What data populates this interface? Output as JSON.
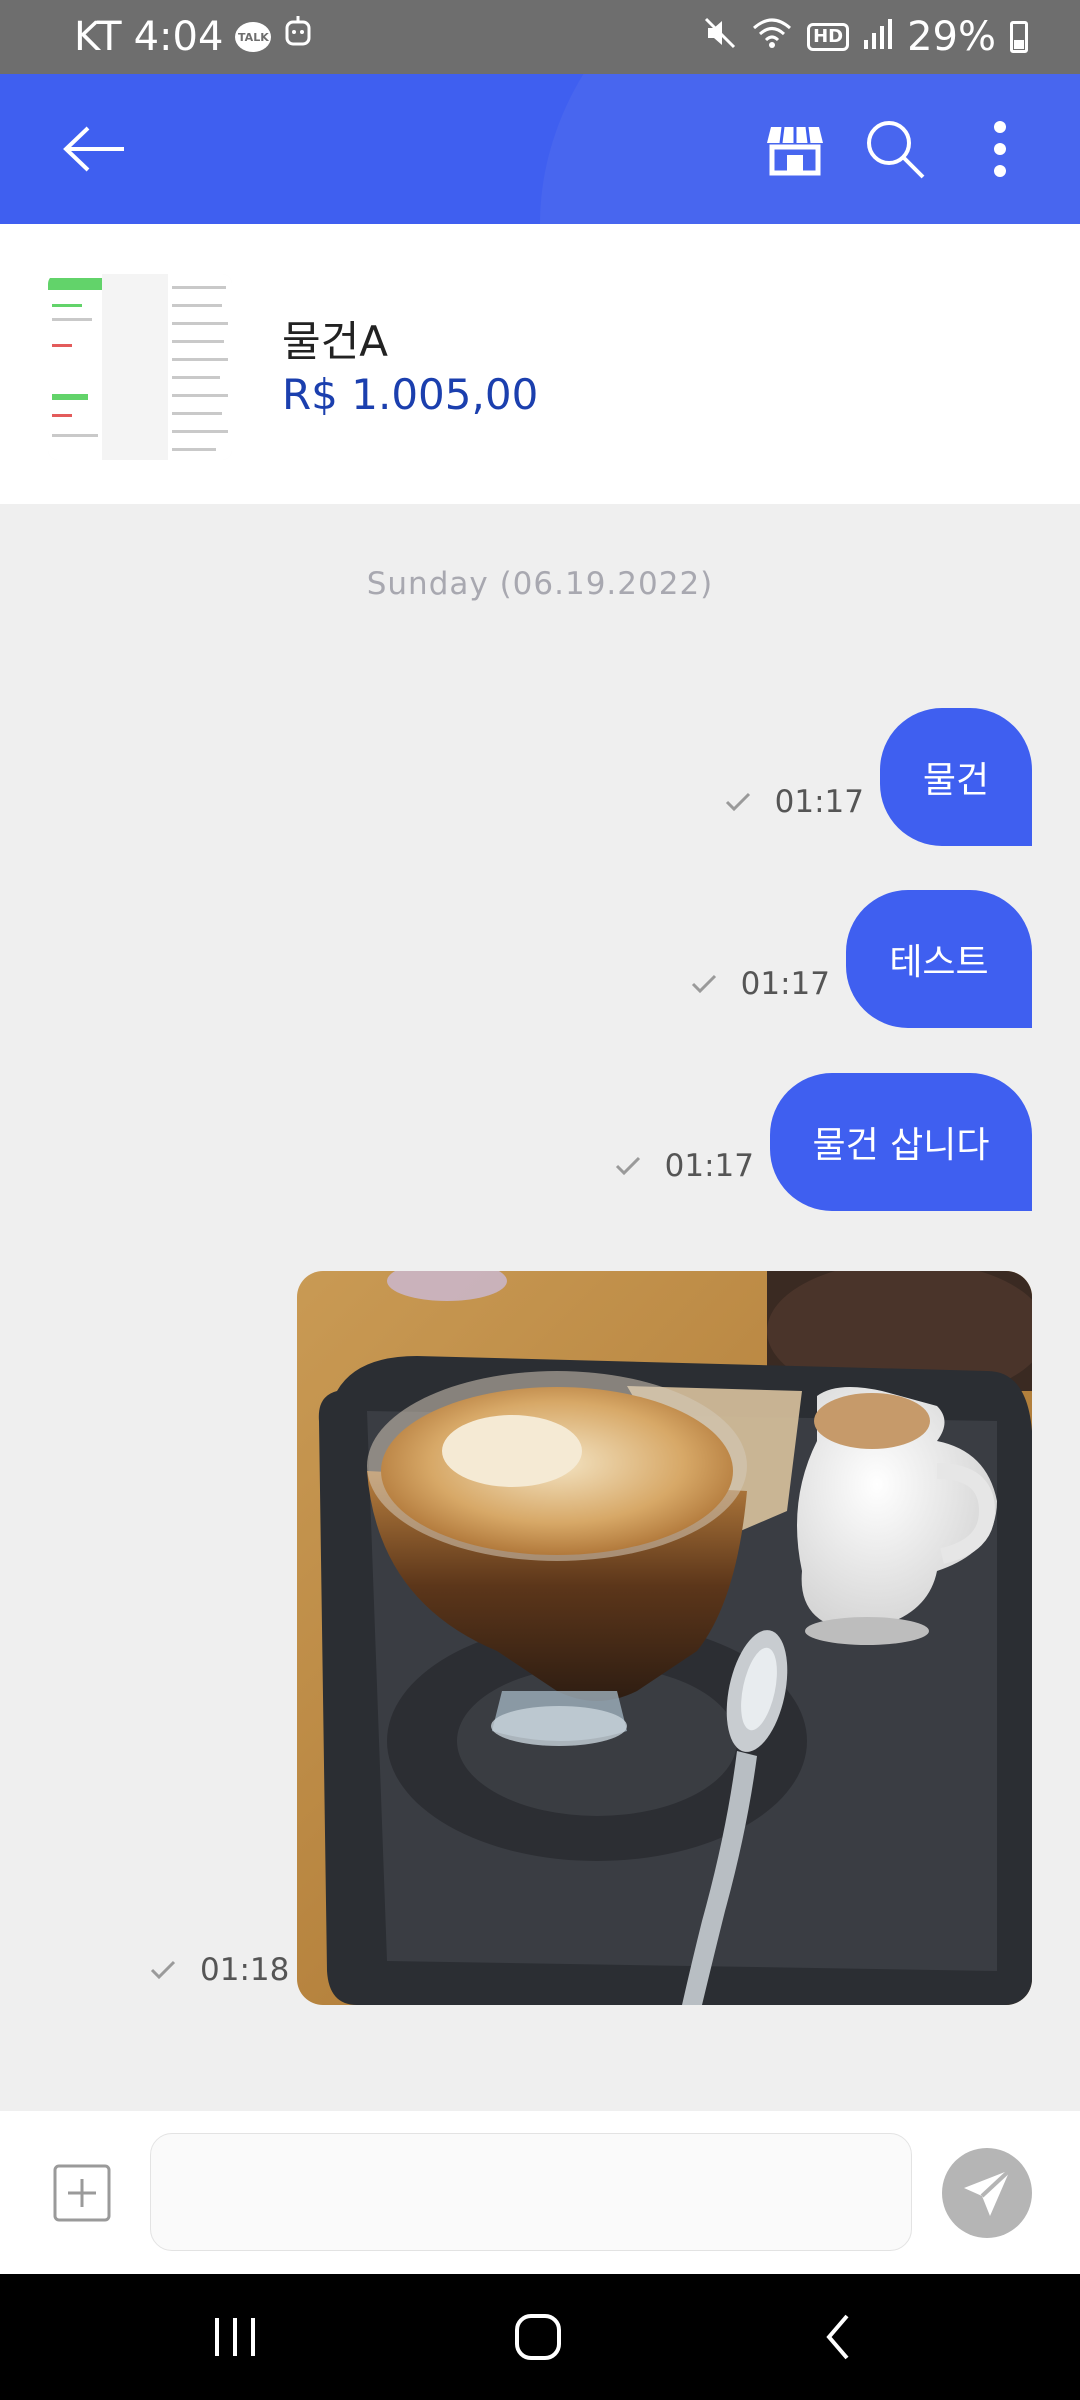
{
  "status_bar": {
    "carrier": "KT",
    "time": "4:04",
    "talk_badge": "TALK",
    "hd_label": "HD",
    "battery": "29%"
  },
  "app_bar": {
    "icons": [
      "back-arrow-icon",
      "store-icon",
      "search-icon",
      "more-vertical-icon"
    ]
  },
  "product": {
    "name": "물건A",
    "price": "R$ 1.005,00"
  },
  "chat": {
    "date": "Sunday (06.19.2022)",
    "messages": [
      {
        "text": "물건",
        "time": "01:17"
      },
      {
        "text": "테스트",
        "time": "01:17"
      },
      {
        "text": "물건 삽니다",
        "time": "01:17"
      }
    ],
    "image_message": {
      "time": "01:18"
    }
  },
  "input": {
    "placeholder": "",
    "value": ""
  },
  "colors": {
    "accent": "#3f5ff0",
    "price": "#1b3fae",
    "status_bar": "#6e6e6e",
    "chat_bg": "#efefef"
  }
}
